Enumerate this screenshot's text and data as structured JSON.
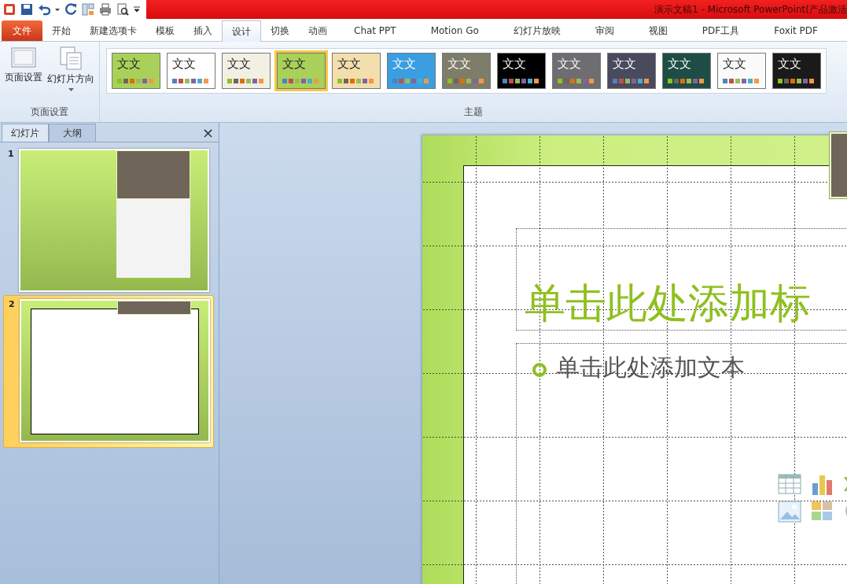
{
  "window": {
    "title": "演示文稿1 - Microsoft PowerPoint(产品激活"
  },
  "ribbon_tabs": [
    {
      "label": "文件",
      "kind": "file",
      "selected": false
    },
    {
      "label": "开始",
      "kind": "tab",
      "selected": false
    },
    {
      "label": "新建选项卡",
      "kind": "tab",
      "selected": false
    },
    {
      "label": "模板",
      "kind": "tab",
      "selected": false
    },
    {
      "label": "插入",
      "kind": "tab",
      "selected": false
    },
    {
      "label": "设计",
      "kind": "tab",
      "selected": true
    },
    {
      "label": "切换",
      "kind": "tab",
      "selected": false
    },
    {
      "label": "动画",
      "kind": "tab",
      "selected": false
    },
    {
      "label": "Chat PPT",
      "kind": "tab",
      "selected": false
    },
    {
      "label": "Motion Go",
      "kind": "tab",
      "selected": false
    },
    {
      "label": "幻灯片放映",
      "kind": "tab",
      "selected": false
    },
    {
      "label": "审阅",
      "kind": "tab",
      "selected": false
    },
    {
      "label": "视图",
      "kind": "tab",
      "selected": false
    },
    {
      "label": "PDF工具",
      "kind": "tab",
      "selected": false
    },
    {
      "label": "Foxit PDF",
      "kind": "tab",
      "selected": false
    }
  ],
  "page_setup_group": {
    "label": "页面设置",
    "buttons": [
      {
        "label": "页面设置",
        "kind": "setup"
      },
      {
        "label": "幻灯片方向",
        "kind": "orientation"
      }
    ]
  },
  "themes_group": {
    "label": "主题",
    "themes": [
      {
        "sample": "文文",
        "color": "#a9d05a",
        "selected": false
      },
      {
        "sample": "文文",
        "color": "#ffffff",
        "selected": false
      },
      {
        "sample": "文文",
        "color": "#f2efe3",
        "selected": false
      },
      {
        "sample": "文文",
        "color": "#a9d05a",
        "selected": true
      },
      {
        "sample": "文文",
        "color": "#f3deae",
        "selected": false
      },
      {
        "sample": "文文",
        "color": "#3a9ee0",
        "selected": false
      },
      {
        "sample": "文文",
        "color": "#7d7d6a",
        "selected": false
      },
      {
        "sample": "文文",
        "color": "#000000",
        "selected": false
      },
      {
        "sample": "文文",
        "color": "#6e6e72",
        "selected": false
      },
      {
        "sample": "文文",
        "color": "#4a4a5e",
        "selected": false
      },
      {
        "sample": "文文",
        "color": "#1e4d46",
        "selected": false
      },
      {
        "sample": "文文",
        "color": "#fafafa",
        "selected": false
      },
      {
        "sample": "文文",
        "color": "#1a1a1a",
        "selected": false
      }
    ]
  },
  "side_panel": {
    "close": "×",
    "tabs": [
      {
        "label": "幻灯片",
        "selected": true
      },
      {
        "label": "大纲",
        "selected": false
      }
    ],
    "slides": [
      {
        "number": "1",
        "kind": "title",
        "selected": false
      },
      {
        "number": "2",
        "kind": "content",
        "selected": true
      }
    ]
  },
  "slide": {
    "title_placeholder": "单击此处添加标",
    "body_placeholder": "单击此处添加文本"
  }
}
